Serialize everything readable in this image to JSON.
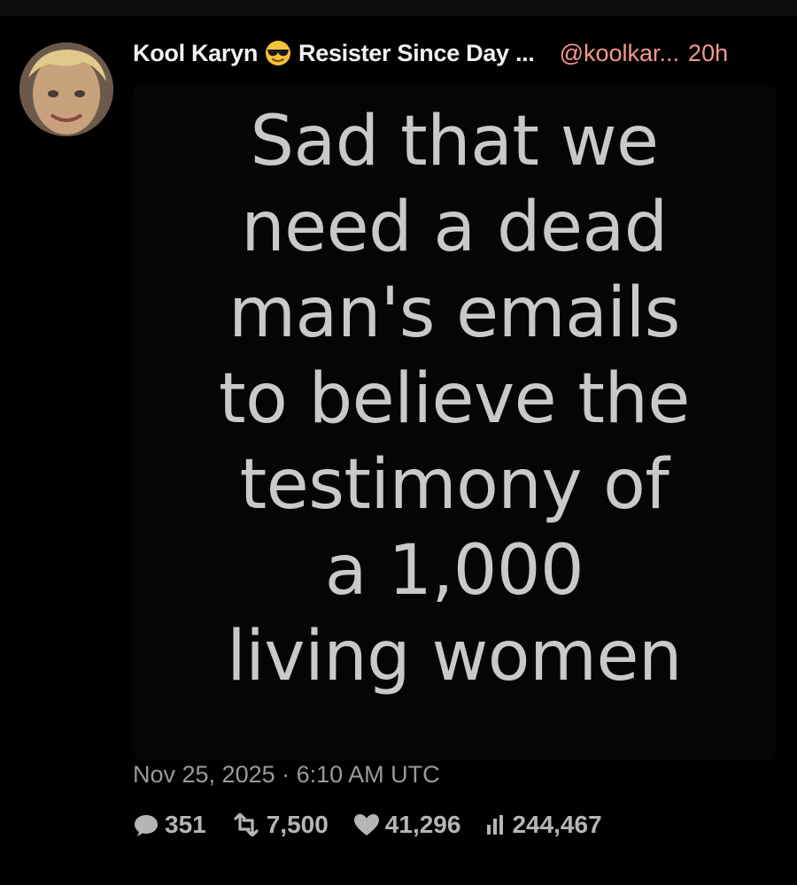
{
  "tweet": {
    "author": {
      "display_name": "Kool Karyn",
      "emoji_icon": "smiling-face-with-sunglasses-emoji",
      "name_suffix": "Resister Since Day ...",
      "handle": "@koolkar...",
      "time_ago": "20h"
    },
    "media_text_lines": [
      "Sad that we",
      "need a dead",
      "man's emails",
      "to believe the",
      "testimony of",
      "a 1,000",
      "living women"
    ],
    "timestamp": "Nov 25, 2025 · 6:10 AM UTC",
    "stats": {
      "replies": "351",
      "retweets": "7,500",
      "likes": "41,296",
      "views": "244,467"
    }
  },
  "colors": {
    "background": "#000000",
    "handle": "#f4978e",
    "media_text": "#c9c9c9",
    "muted": "#9a9a9a"
  }
}
